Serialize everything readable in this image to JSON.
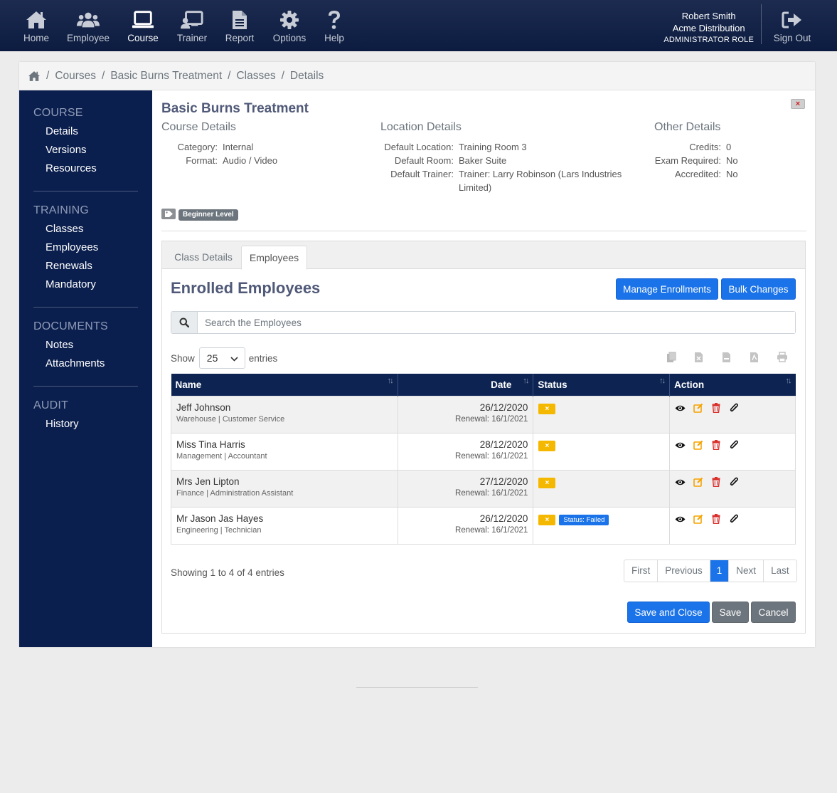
{
  "nav": {
    "items": [
      {
        "label": "Home",
        "icon": "home-icon"
      },
      {
        "label": "Employee",
        "icon": "users-icon"
      },
      {
        "label": "Course",
        "icon": "laptop-icon"
      },
      {
        "label": "Trainer",
        "icon": "trainer-icon"
      },
      {
        "label": "Report",
        "icon": "document-icon"
      },
      {
        "label": "Options",
        "icon": "gear-icon"
      },
      {
        "label": "Help",
        "icon": "question-icon"
      }
    ],
    "active": "Course",
    "user_name": "Robert Smith",
    "company": "Acme Distribution",
    "role": "ADMINISTRATOR ROLE",
    "signout_label": "Sign Out"
  },
  "breadcrumb": [
    "Courses",
    "Basic Burns Treatment",
    "Classes",
    "Details"
  ],
  "sidebar": {
    "sections": [
      {
        "heading": "COURSE",
        "items": [
          "Details",
          "Versions",
          "Resources"
        ]
      },
      {
        "heading": "TRAINING",
        "items": [
          "Classes",
          "Employees",
          "Renewals",
          "Mandatory"
        ]
      },
      {
        "heading": "DOCUMENTS",
        "items": [
          "Notes",
          "Attachments"
        ]
      },
      {
        "heading": "AUDIT",
        "items": [
          "History"
        ]
      }
    ]
  },
  "course": {
    "title": "Basic Burns Treatment",
    "course_details": {
      "heading": "Course Details",
      "rows": [
        {
          "key": "Category:",
          "value": "Internal"
        },
        {
          "key": "Format:",
          "value": "Audio / Video"
        }
      ]
    },
    "location_details": {
      "heading": "Location Details",
      "rows": [
        {
          "key": "Default Location:",
          "value": "Training Room 3"
        },
        {
          "key": "Default Room:",
          "value": "Baker Suite"
        },
        {
          "key": "Default Trainer:",
          "value": "Trainer: Larry Robinson (Lars Industries Limited)"
        }
      ]
    },
    "other_details": {
      "heading": "Other Details",
      "rows": [
        {
          "key": "Credits:",
          "value": "0"
        },
        {
          "key": "Exam Required:",
          "value": "No"
        },
        {
          "key": "Accredited:",
          "value": "No"
        }
      ]
    },
    "tag": "Beginner Level",
    "close_label": "×"
  },
  "tabs": [
    "Class Details",
    "Employees"
  ],
  "active_tab": "Employees",
  "enrolled": {
    "title": "Enrolled Employees",
    "manage_label": "Manage Enrollments",
    "bulk_label": "Bulk Changes",
    "search_placeholder": "Search the Employees",
    "show_label": "Show",
    "entries_value": "25",
    "entries_label": "entries",
    "export_icons": [
      "copy-icon",
      "excel-icon",
      "csv-icon",
      "pdf-icon",
      "print-icon"
    ]
  },
  "table": {
    "headers": [
      "Name",
      "Date",
      "Status",
      "Action"
    ],
    "renewal_label": "Renewal:",
    "rows": [
      {
        "name": "Jeff Johnson",
        "sub": "Warehouse | Customer Service",
        "date": "26/12/2020",
        "renewal": "16/1/2021",
        "status": "×",
        "extra": ""
      },
      {
        "name": "Miss Tina Harris",
        "sub": "Management | Accountant",
        "date": "28/12/2020",
        "renewal": "16/1/2021",
        "status": "×",
        "extra": ""
      },
      {
        "name": "Mrs Jen Lipton",
        "sub": "Finance | Administration Assistant",
        "date": "27/12/2020",
        "renewal": "16/1/2021",
        "status": "×",
        "extra": ""
      },
      {
        "name": "Mr Jason Jas Hayes",
        "sub": "Engineering | Technician",
        "date": "26/12/2020",
        "renewal": "16/1/2021",
        "status": "×",
        "extra": "Status: Failed"
      }
    ]
  },
  "pagination": {
    "showing": "Showing 1 to 4 of 4 entries",
    "pages": [
      "First",
      "Previous",
      "1",
      "Next",
      "Last"
    ],
    "active": "1"
  },
  "actions": {
    "save_close": "Save and Close",
    "save": "Save",
    "cancel": "Cancel"
  },
  "colors": {
    "nav_bg": "#0c1c40",
    "sidebar_bg": "#0b1f4e",
    "primary": "#1a73e8",
    "secondary": "#6c757d",
    "warning": "#f5b800",
    "danger": "#d9302c"
  }
}
